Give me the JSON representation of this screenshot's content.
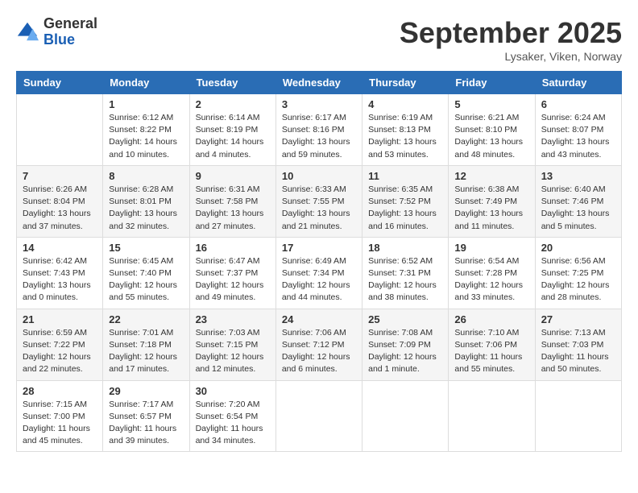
{
  "header": {
    "logo_general": "General",
    "logo_blue": "Blue",
    "month_title": "September 2025",
    "location": "Lysaker, Viken, Norway"
  },
  "weekdays": [
    "Sunday",
    "Monday",
    "Tuesday",
    "Wednesday",
    "Thursday",
    "Friday",
    "Saturday"
  ],
  "weeks": [
    [
      {
        "day": "",
        "info": ""
      },
      {
        "day": "1",
        "info": "Sunrise: 6:12 AM\nSunset: 8:22 PM\nDaylight: 14 hours\nand 10 minutes."
      },
      {
        "day": "2",
        "info": "Sunrise: 6:14 AM\nSunset: 8:19 PM\nDaylight: 14 hours\nand 4 minutes."
      },
      {
        "day": "3",
        "info": "Sunrise: 6:17 AM\nSunset: 8:16 PM\nDaylight: 13 hours\nand 59 minutes."
      },
      {
        "day": "4",
        "info": "Sunrise: 6:19 AM\nSunset: 8:13 PM\nDaylight: 13 hours\nand 53 minutes."
      },
      {
        "day": "5",
        "info": "Sunrise: 6:21 AM\nSunset: 8:10 PM\nDaylight: 13 hours\nand 48 minutes."
      },
      {
        "day": "6",
        "info": "Sunrise: 6:24 AM\nSunset: 8:07 PM\nDaylight: 13 hours\nand 43 minutes."
      }
    ],
    [
      {
        "day": "7",
        "info": "Sunrise: 6:26 AM\nSunset: 8:04 PM\nDaylight: 13 hours\nand 37 minutes."
      },
      {
        "day": "8",
        "info": "Sunrise: 6:28 AM\nSunset: 8:01 PM\nDaylight: 13 hours\nand 32 minutes."
      },
      {
        "day": "9",
        "info": "Sunrise: 6:31 AM\nSunset: 7:58 PM\nDaylight: 13 hours\nand 27 minutes."
      },
      {
        "day": "10",
        "info": "Sunrise: 6:33 AM\nSunset: 7:55 PM\nDaylight: 13 hours\nand 21 minutes."
      },
      {
        "day": "11",
        "info": "Sunrise: 6:35 AM\nSunset: 7:52 PM\nDaylight: 13 hours\nand 16 minutes."
      },
      {
        "day": "12",
        "info": "Sunrise: 6:38 AM\nSunset: 7:49 PM\nDaylight: 13 hours\nand 11 minutes."
      },
      {
        "day": "13",
        "info": "Sunrise: 6:40 AM\nSunset: 7:46 PM\nDaylight: 13 hours\nand 5 minutes."
      }
    ],
    [
      {
        "day": "14",
        "info": "Sunrise: 6:42 AM\nSunset: 7:43 PM\nDaylight: 13 hours\nand 0 minutes."
      },
      {
        "day": "15",
        "info": "Sunrise: 6:45 AM\nSunset: 7:40 PM\nDaylight: 12 hours\nand 55 minutes."
      },
      {
        "day": "16",
        "info": "Sunrise: 6:47 AM\nSunset: 7:37 PM\nDaylight: 12 hours\nand 49 minutes."
      },
      {
        "day": "17",
        "info": "Sunrise: 6:49 AM\nSunset: 7:34 PM\nDaylight: 12 hours\nand 44 minutes."
      },
      {
        "day": "18",
        "info": "Sunrise: 6:52 AM\nSunset: 7:31 PM\nDaylight: 12 hours\nand 38 minutes."
      },
      {
        "day": "19",
        "info": "Sunrise: 6:54 AM\nSunset: 7:28 PM\nDaylight: 12 hours\nand 33 minutes."
      },
      {
        "day": "20",
        "info": "Sunrise: 6:56 AM\nSunset: 7:25 PM\nDaylight: 12 hours\nand 28 minutes."
      }
    ],
    [
      {
        "day": "21",
        "info": "Sunrise: 6:59 AM\nSunset: 7:22 PM\nDaylight: 12 hours\nand 22 minutes."
      },
      {
        "day": "22",
        "info": "Sunrise: 7:01 AM\nSunset: 7:18 PM\nDaylight: 12 hours\nand 17 minutes."
      },
      {
        "day": "23",
        "info": "Sunrise: 7:03 AM\nSunset: 7:15 PM\nDaylight: 12 hours\nand 12 minutes."
      },
      {
        "day": "24",
        "info": "Sunrise: 7:06 AM\nSunset: 7:12 PM\nDaylight: 12 hours\nand 6 minutes."
      },
      {
        "day": "25",
        "info": "Sunrise: 7:08 AM\nSunset: 7:09 PM\nDaylight: 12 hours\nand 1 minute."
      },
      {
        "day": "26",
        "info": "Sunrise: 7:10 AM\nSunset: 7:06 PM\nDaylight: 11 hours\nand 55 minutes."
      },
      {
        "day": "27",
        "info": "Sunrise: 7:13 AM\nSunset: 7:03 PM\nDaylight: 11 hours\nand 50 minutes."
      }
    ],
    [
      {
        "day": "28",
        "info": "Sunrise: 7:15 AM\nSunset: 7:00 PM\nDaylight: 11 hours\nand 45 minutes."
      },
      {
        "day": "29",
        "info": "Sunrise: 7:17 AM\nSunset: 6:57 PM\nDaylight: 11 hours\nand 39 minutes."
      },
      {
        "day": "30",
        "info": "Sunrise: 7:20 AM\nSunset: 6:54 PM\nDaylight: 11 hours\nand 34 minutes."
      },
      {
        "day": "",
        "info": ""
      },
      {
        "day": "",
        "info": ""
      },
      {
        "day": "",
        "info": ""
      },
      {
        "day": "",
        "info": ""
      }
    ]
  ]
}
